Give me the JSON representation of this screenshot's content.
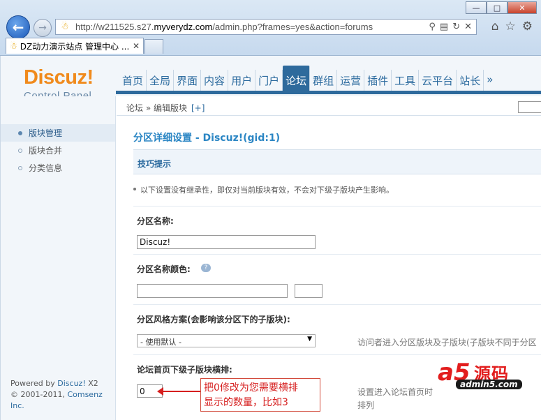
{
  "browser": {
    "window_buttons": [
      "—",
      "□",
      "✕"
    ],
    "url_prefix": "http://w211525.s27.",
    "url_domain": "myverydz.com",
    "url_suffix": "/admin.php?frames=yes&action=forums",
    "tab_title": "DZ动力演示站点 管理中心 ...",
    "tab_close": "✕"
  },
  "logo": {
    "main": "Discuz!",
    "sub": "Control Panel"
  },
  "nav": {
    "items": [
      "首页",
      "全局",
      "界面",
      "内容",
      "用户",
      "门户",
      "论坛",
      "群组",
      "运营",
      "插件",
      "工具",
      "云平台",
      "站长",
      "»"
    ],
    "active": "论坛"
  },
  "sidebar": {
    "items": [
      {
        "label": "版块管理",
        "active": true
      },
      {
        "label": "版块合并",
        "active": false
      },
      {
        "label": "分类信息",
        "active": false
      }
    ]
  },
  "footer": {
    "powered_prefix": "Powered by ",
    "powered_link": "Discuz!",
    "powered_version": " X2",
    "copyright_prefix": "© 2001-2011, ",
    "copyright_link": "Comsenz Inc."
  },
  "breadcrumb": {
    "text": "论坛 » 编辑版块",
    "add": "[+]"
  },
  "section_title": "分区详细设置 - Discuz!(gid:1)",
  "tips": {
    "title": "技巧提示",
    "text": "以下设置没有继承性，即仅对当前版块有效，不会对下级子版块产生影响。"
  },
  "form": {
    "name_label": "分区名称:",
    "name_value": "Discuz!",
    "color_label": "分区名称颜色:",
    "color_value": "",
    "style_label": "分区风格方案(会影响该分区下的子版块):",
    "style_selected": "- 使用默认 -",
    "style_hint": "访问者进入分区版块及子版块(子版块不同于分区",
    "cols_label": "论坛首页下级子版块横排:",
    "cols_value": "0",
    "cols_hint_1": "设置进入论坛首页时",
    "cols_hint_2": "排列"
  },
  "annotation": {
    "line1": "把0修改为您需要横排",
    "line2": "显示的数量，比如3"
  },
  "watermark": {
    "logo": "a5",
    "name": "源码",
    "url": "admin5.com"
  },
  "colors": {
    "accent": "#2e6a9c",
    "logo": "#f08a1c",
    "title": "#2b86c4",
    "annotation": "#d61f1f"
  }
}
